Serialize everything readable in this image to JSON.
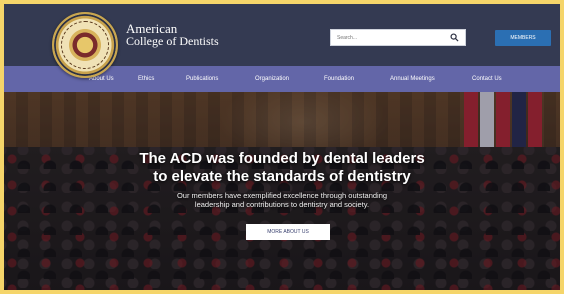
{
  "header": {
    "brand_line1": "American",
    "brand_line2": "College of Dentists",
    "search_placeholder": "Search...",
    "member_button": "MEMBERS"
  },
  "nav": {
    "items": [
      {
        "label": "About Us"
      },
      {
        "label": "Ethics"
      },
      {
        "label": "Publications"
      },
      {
        "label": "Organization"
      },
      {
        "label": "Foundation"
      },
      {
        "label": "Annual Meetings"
      },
      {
        "label": "Contact Us"
      }
    ]
  },
  "hero": {
    "headline_line1": "The ACD was founded by dental leaders",
    "headline_line2": "to elevate the standards of dentistry",
    "subtext_line1": "Our members have exemplified excellence through outstanding",
    "subtext_line2": "leadership and contributions to dentistry and society.",
    "cta_label": "MORE ABOUT US"
  },
  "colors": {
    "header_bg": "#343a52",
    "nav_bg": "#6366a8",
    "accent": "#2b6fb3",
    "outer_border": "#f5d56a"
  },
  "icons": {
    "logo": "acd-seal-logo",
    "search": "search-icon"
  }
}
